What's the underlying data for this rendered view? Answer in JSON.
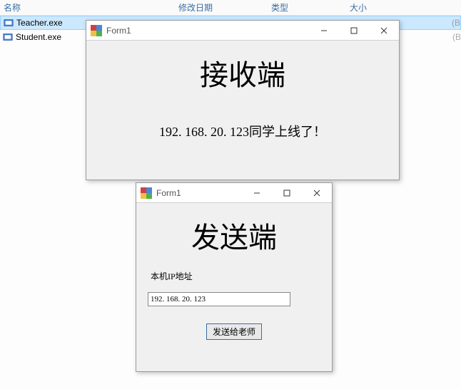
{
  "explorer": {
    "columns": {
      "name": "名称",
      "date": "修改日期",
      "type": "类型",
      "size": "大小"
    },
    "rows": [
      {
        "name": "Teacher.exe",
        "sizehint": "(B"
      },
      {
        "name": "Student.exe",
        "sizehint": "(B"
      }
    ]
  },
  "window1": {
    "title": "Form1",
    "heading": "接收端",
    "status": "192. 168. 20. 123同学上线了！"
  },
  "window2": {
    "title": "Form1",
    "heading": "发送端",
    "ip_label": "本机IP地址",
    "ip_value": "192. 168. 20. 123",
    "send_label": "发送给老师"
  }
}
